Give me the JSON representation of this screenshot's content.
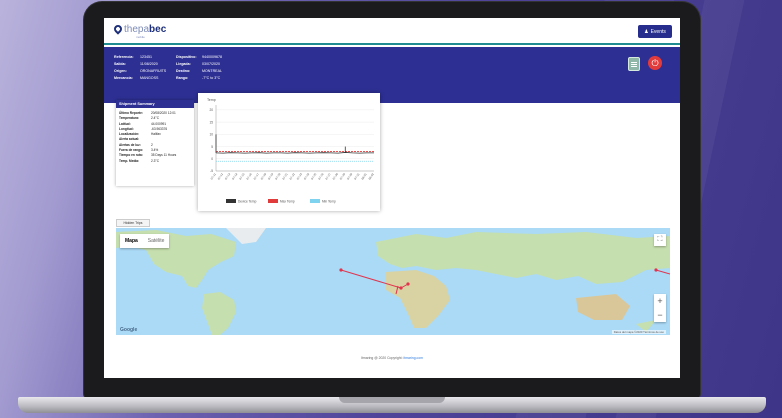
{
  "header": {
    "logo_main": "thepa",
    "logo_brand": "bec",
    "logo_sub": "mobile",
    "events_button": "Events"
  },
  "shipment_info": {
    "rows": [
      [
        "Referencia:",
        "123451",
        "Dispositivo:",
        "9440009678"
      ],
      [
        "Salida:",
        "11/08/2020",
        "Llegada:",
        "03/07/2020"
      ],
      [
        "Origen:",
        "ORONAFRUITS",
        "Destino:",
        "MONTREAL"
      ],
      [
        "Mercancía:",
        "MANGOSS",
        "Rango:",
        "-7°C to 3°C"
      ]
    ]
  },
  "summary": {
    "title": "Shipment Summary",
    "rows": [
      [
        "Último Reporte:",
        "20/08/2020 12:01"
      ],
      [
        "Temperatura:",
        "2.4°C"
      ],
      [
        "Latitud:",
        "44.000991"
      ],
      [
        "Longitud:",
        "-63.963376"
      ],
      [
        "Localización:",
        "Halifax"
      ],
      [
        "Alerta actual:",
        ""
      ],
      [
        "Alertas de luz:",
        "2"
      ],
      [
        "Fuera de rango:",
        "3.4%"
      ],
      [
        "Tiempo en ruta:",
        "35 Days 11 Hours"
      ],
      [
        "Temp. Media:",
        "2.3°C"
      ]
    ]
  },
  "chart_data": {
    "type": "line",
    "title": "Temp",
    "yticks": [
      20,
      15,
      10,
      5,
      0,
      -5
    ],
    "ylim": [
      -5,
      22
    ],
    "x": [
      "07-11",
      "07-12",
      "07-13",
      "07-14",
      "07-15",
      "07-16",
      "07-17",
      "07-18",
      "07-19",
      "07-20",
      "07-21",
      "07-22",
      "07-23",
      "07-24",
      "07-25",
      "07-26",
      "07-27",
      "07-28",
      "07-29",
      "07-30",
      "07-31",
      "08-01",
      "08-02"
    ],
    "series": [
      {
        "name": "Device Temp",
        "color": "#333333",
        "values": [
          2.4,
          2.3,
          2.5,
          2.4,
          2.3,
          2.4,
          2.5,
          2.3,
          2.4,
          2.4,
          2.3,
          2.5,
          2.4,
          2.3,
          2.4,
          2.5,
          2.4,
          2.3,
          2.6,
          2.4,
          2.3,
          2.4,
          2.4
        ]
      },
      {
        "name": "Max Temp",
        "color": "#e23b3b",
        "values": [
          3,
          3,
          3,
          3,
          3,
          3,
          3,
          3,
          3,
          3,
          3,
          3,
          3,
          3,
          3,
          3,
          3,
          3,
          3,
          3,
          3,
          3,
          3
        ]
      },
      {
        "name": "Min Temp",
        "color": "#7fd3ef",
        "values": [
          -1,
          -1,
          -1,
          -1,
          -1,
          -1,
          -1,
          -1,
          -1,
          -1,
          -1,
          -1,
          -1,
          -1,
          -1,
          -1,
          -1,
          -1,
          -1,
          -1,
          -1,
          -1,
          -1
        ]
      }
    ],
    "spikes": [
      {
        "x": "07-11",
        "y": 10
      },
      {
        "x": "07-29",
        "y": 5
      }
    ],
    "legend_position": "bottom",
    "grid": true
  },
  "tabs": {
    "hidden_trips": "Hidden Trips"
  },
  "map": {
    "map_label": "Mapa",
    "satellite_label": "Satélite",
    "google_label": "Google",
    "credits": "Datos del mapa ©2020   Términos de uso",
    "route_color": "#e2344d"
  },
  "footer": {
    "text": "Itmaring @ 2020 Copyright: ",
    "link": "itmaring.com"
  },
  "icons": {
    "events": "user-icon",
    "report": "document-icon",
    "power": "power-icon",
    "fullscreen": "fullscreen-icon"
  }
}
